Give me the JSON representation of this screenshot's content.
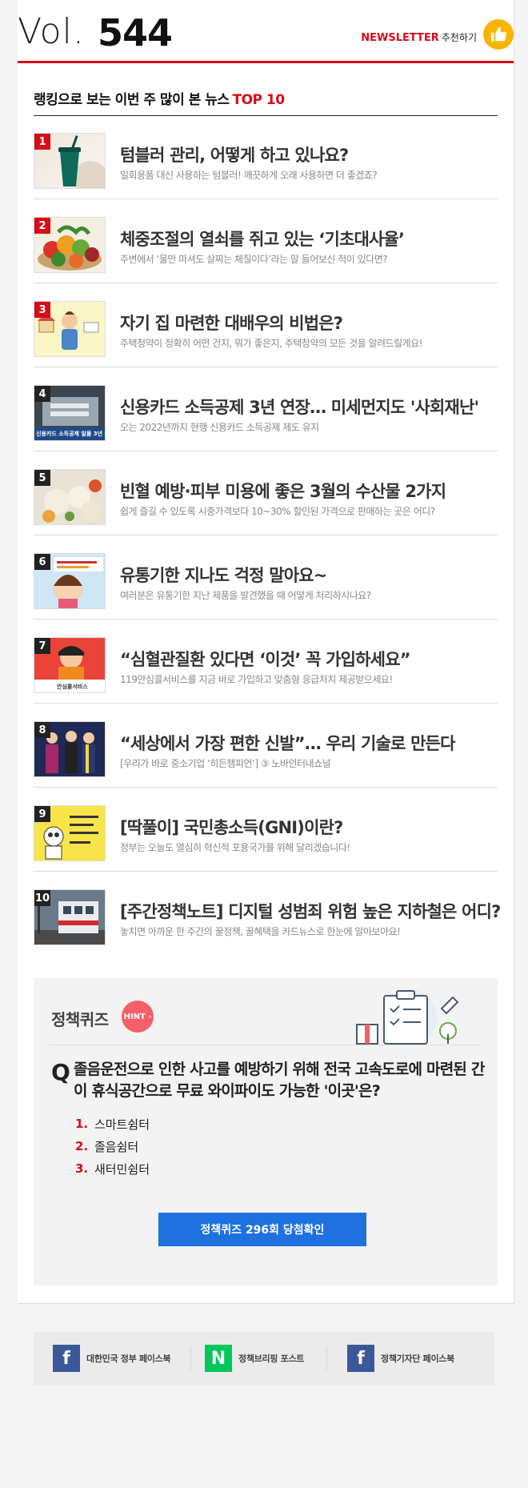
{
  "header": {
    "vol_prefix": "Vol.",
    "vol_number": "544",
    "newsletter_label": "NEWSLETTER",
    "recommend_label": "추천하기"
  },
  "section": {
    "title": "랭킹으로 보는 이번 주 많이 본 뉴스",
    "title_accent": "TOP 10"
  },
  "news": [
    {
      "rank": "1",
      "title": "텀블러 관리, 어떻게 하고 있나요?",
      "desc": "일회용품 대신 사용하는 텀블러! 깨끗하게 오래 사용하면 더 좋겠죠?"
    },
    {
      "rank": "2",
      "title": "체중조절의 열쇠를 쥐고 있는 ‘기초대사율’",
      "desc": "주변에서 ‘물만 마셔도 살찌는 체질이다’라는 말 들어보신 적이 있다면?"
    },
    {
      "rank": "3",
      "title": "자기 집 마련한 대배우의 비법은?",
      "desc": "주택청약이 정확히 어떤 건지, 뭐가 좋은지, 주택청약의 모든 것을 알려드릴게요!"
    },
    {
      "rank": "4",
      "title": "신용카드 소득공제 3년 연장… 미세먼지도 '사회재난'",
      "desc": "오는 2022년까지 현행 신용카드 소득공제 제도 유지",
      "thumb_caption": "신용카드 소득공제 일몰 3년 연"
    },
    {
      "rank": "5",
      "title": "빈혈 예방·피부 미용에 좋은 3월의 수산물 2가지",
      "desc": "쉽게 즐길 수 있도록 시중가격보다 10~30% 할인된 가격으로 판매하는 곳은 어디?"
    },
    {
      "rank": "6",
      "title": "유통기한 지나도 걱정 말아요~",
      "desc": "여러분은 유통기한 지난 제품을 발견했을 때 어떻게 처리하시나요?"
    },
    {
      "rank": "7",
      "title": "“심혈관질환 있다면 ‘이것’ 꼭 가입하세요”",
      "desc": "119안심콜서비스를 지금 바로 가입하고 맞춤형 응급처치 제공받으세요!",
      "thumb_caption": "안심콜서비스"
    },
    {
      "rank": "8",
      "title": "“세상에서 가장 편한 신발”… 우리 기술로 만든다",
      "desc": "[우리가 바로 중소기업 ‘히든챔피언’] ③ 노바인터내쇼널"
    },
    {
      "rank": "9",
      "title": "[딱풀이] 국민총소득(GNI)이란?",
      "desc": "정부는 오늘도 열심히 혁신적 포용국가를 위해 달리겠습니다!"
    },
    {
      "rank": "10",
      "title": "[주간정책노트] 디지털 성범죄 위험 높은 지하철은 어디?",
      "desc": "놓치면 아까운 한 주간의 꿀정책, 꿀혜택을 카드뉴스로 한눈에 알아보아요!"
    }
  ],
  "quiz": {
    "title": "정책퀴즈",
    "hint": "HINT",
    "q_mark": "Q",
    "question": "졸음운전으로 인한 사고를 예방하기 위해 전국 고속도로에 마련된 간이 휴식공간으로 무료 와이파이도 가능한 '이곳'은?",
    "options": [
      {
        "num": "1.",
        "text": "스마트쉼터"
      },
      {
        "num": "2.",
        "text": "졸음쉼터"
      },
      {
        "num": "3.",
        "text": "새터민쉼터"
      }
    ],
    "button": "정책퀴즈 296회 당첨확인"
  },
  "footer": [
    {
      "icon": "f",
      "label": "대한민국 정부 페이스북",
      "color": "#3b5998"
    },
    {
      "icon": "N",
      "label": "정책브리핑 포스트",
      "color": "#03c75a"
    },
    {
      "icon": "f",
      "label": "정책기자단 페이스북",
      "color": "#3b5998"
    }
  ],
  "colors": {
    "accent": "#d80c18",
    "button": "#1f70e0",
    "hint": "#f46068",
    "like": "#f7b500"
  }
}
